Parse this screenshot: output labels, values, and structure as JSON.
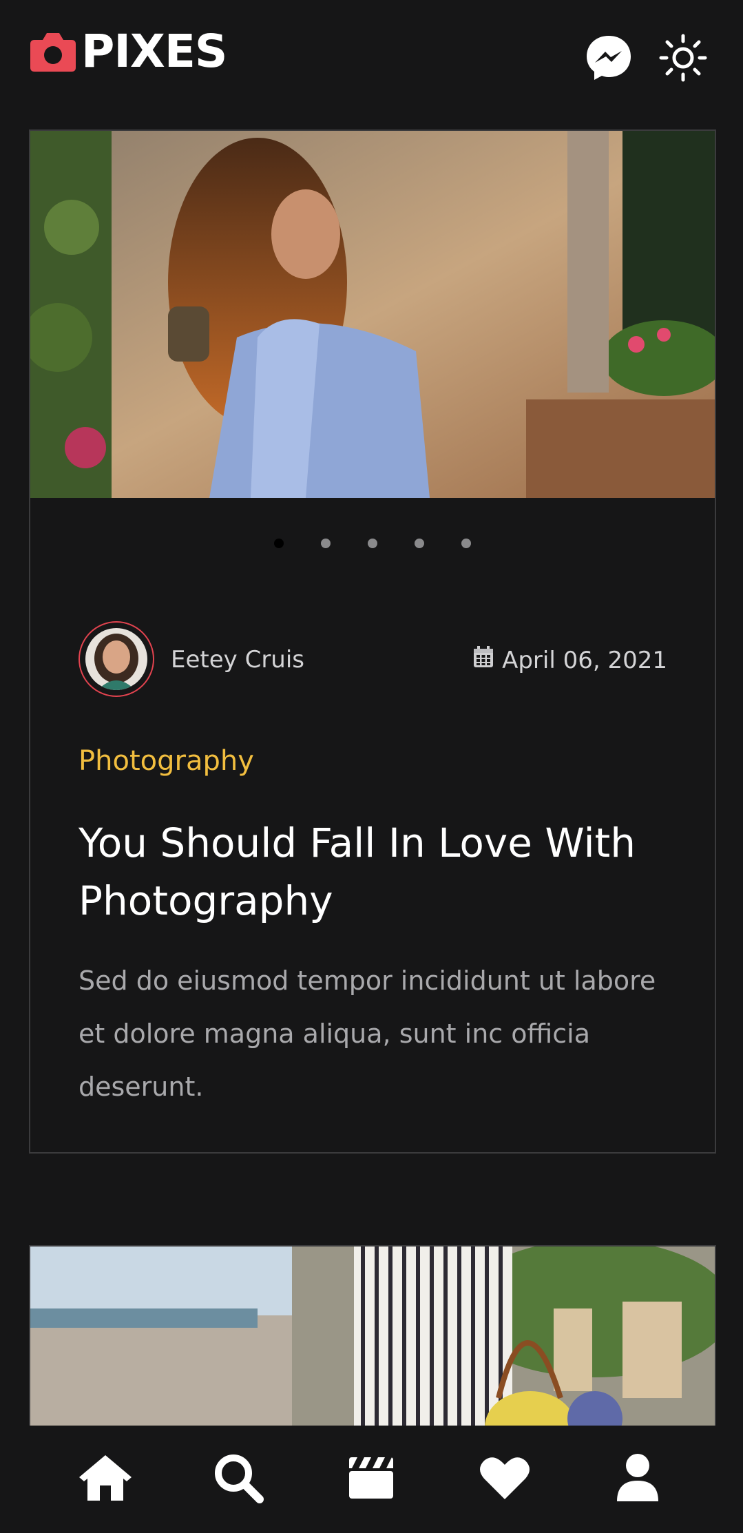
{
  "header": {
    "logo_text": "PIXES",
    "icons": {
      "messenger": "messenger-icon",
      "theme": "sun-icon",
      "logo": "camera-icon"
    }
  },
  "post1": {
    "author": "Eetey Cruis",
    "date": "April 06, 2021",
    "category": "Photography",
    "title": "You Should Fall In Love With Photography",
    "excerpt": "Sed do eiusmod tempor incididunt ut labore et dolore magna aliqua, sunt inc officia deserunt.",
    "carousel": {
      "slide_count": 5,
      "active_index": 0
    }
  },
  "bottom_nav": {
    "items": [
      "home-icon",
      "search-icon",
      "clapperboard-icon",
      "heart-icon",
      "user-icon"
    ]
  },
  "colors": {
    "background": "#161617",
    "accent": "#ea4a55",
    "category": "#f2be3f",
    "border": "#3b3b3d"
  }
}
